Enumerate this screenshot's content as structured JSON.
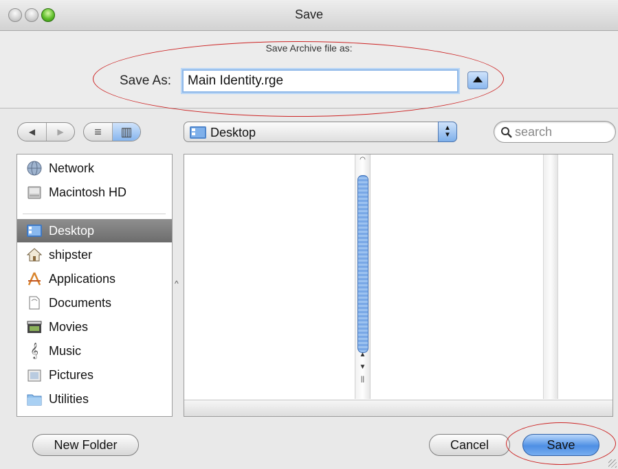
{
  "window": {
    "title": "Save"
  },
  "dialog": {
    "subtitle": "Save Archive file as:",
    "save_as_label": "Save As:",
    "filename": "Main Identity.rge"
  },
  "toolbar": {
    "back_label": "◀",
    "forward_label": "▶",
    "list_view_label": "≡",
    "column_view_label": "▥",
    "location": "Desktop",
    "search_placeholder": "search"
  },
  "sidebar": {
    "devices": [
      {
        "label": "Network",
        "icon": "network-icon"
      },
      {
        "label": "Macintosh HD",
        "icon": "hard-drive-icon"
      }
    ],
    "places": [
      {
        "label": "Desktop",
        "icon": "desktop-icon",
        "selected": true
      },
      {
        "label": "shipster",
        "icon": "home-icon"
      },
      {
        "label": "Applications",
        "icon": "applications-icon"
      },
      {
        "label": "Documents",
        "icon": "documents-icon"
      },
      {
        "label": "Movies",
        "icon": "movies-icon"
      },
      {
        "label": "Music",
        "icon": "music-icon"
      },
      {
        "label": "Pictures",
        "icon": "pictures-icon"
      },
      {
        "label": "Utilities",
        "icon": "folder-icon"
      }
    ]
  },
  "buttons": {
    "new_folder": "New Folder",
    "cancel": "Cancel",
    "save": "Save"
  },
  "colors": {
    "annotation_circle": "#cc2222",
    "selection": "#7a7a7a",
    "default_button": "#4e8fe4"
  }
}
